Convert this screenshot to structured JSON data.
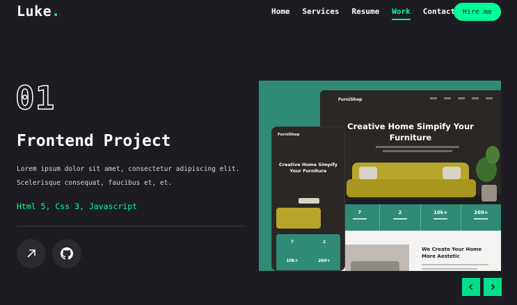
{
  "header": {
    "logo": "Luke",
    "logo_dot": ".",
    "nav": [
      {
        "label": "Home",
        "active": false
      },
      {
        "label": "Services",
        "active": false
      },
      {
        "label": "Resume",
        "active": false
      },
      {
        "label": "Work",
        "active": true
      },
      {
        "label": "Contact",
        "active": false
      }
    ],
    "hire_label": "Hire me"
  },
  "project": {
    "number": "01",
    "title": "Frontend Project",
    "description_line1": "Lorem ipsum dolor sit amet, consectetur adipiscing elit.",
    "description_line2": "Scelerisque consequat, faucibus et, et.",
    "stack": "Html 5, Css 3, Javascript"
  },
  "preview": {
    "desktop_brand": "FurniShop",
    "desktop_hero_line1": "Creative Home Simpify Your",
    "desktop_hero_line2": "Furniture",
    "stats": [
      "7",
      "2",
      "10k+",
      "260+"
    ],
    "section_title_line1": "We Create Your Home",
    "section_title_line2": "More Aestetic",
    "mobile_brand": "FurniShop",
    "mobile_hero_line1": "Creative Home Simpify",
    "mobile_hero_line2": "Your Furniture",
    "mobile_stats": [
      "7",
      "2",
      "10k+",
      "260+"
    ]
  },
  "colors": {
    "accent": "#00ff99",
    "background": "#1c1c22",
    "showcase": "#2f8a76"
  },
  "icons": {
    "live_link": "arrow-up-right-icon",
    "repo_link": "github-icon",
    "prev": "chevron-left-icon",
    "next": "chevron-right-icon"
  }
}
